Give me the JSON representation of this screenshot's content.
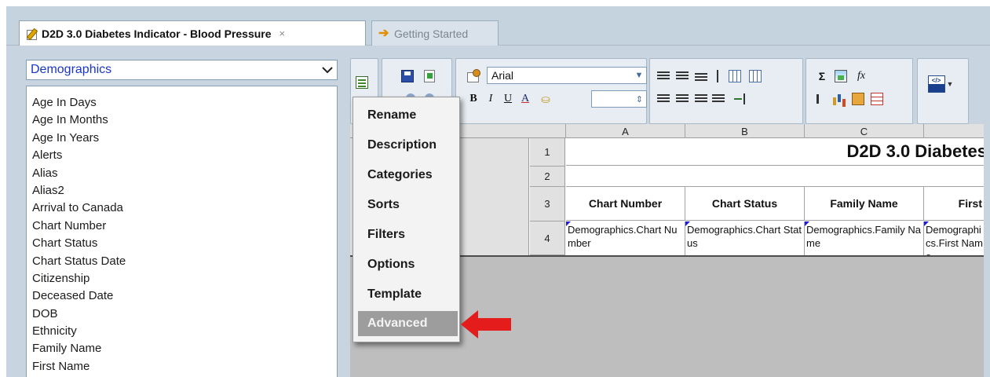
{
  "tabs": [
    {
      "label": "D2D 3.0 Diabetes Indicator - Blood Pressure",
      "close": "×",
      "active": true
    },
    {
      "label": "Getting Started",
      "active": false
    }
  ],
  "category_select": {
    "value": "Demographics"
  },
  "field_list": [
    "Age In Days",
    "Age In Months",
    "Age In Years",
    "Alerts",
    "Alias",
    "Alias2",
    "Arrival to Canada",
    "Chart Number",
    "Chart Status",
    "Chart Status Date",
    "Citizenship",
    "Deceased Date",
    "DOB",
    "Ethnicity",
    "Family Name",
    "First Name"
  ],
  "toolbar": {
    "font_family": "Arial",
    "bold": "B",
    "italic": "I",
    "underline": "U",
    "font_color": "A",
    "sum": "Σ",
    "function": "fx",
    "html": "</>"
  },
  "menu": [
    "Rename",
    "Description",
    "Categories",
    "Sorts",
    "Filters",
    "Options",
    "Template",
    "Advanced"
  ],
  "menu_selected": "Advanced",
  "sheet": {
    "column_letters": [
      "A",
      "B",
      "C"
    ],
    "row_numbers": [
      "1",
      "2",
      "3",
      "4"
    ],
    "title": "D2D 3.0 Diabetes",
    "headers": [
      "Chart Number",
      "Chart Status",
      "Family Name",
      "First"
    ],
    "data_row": [
      "Demographics.Chart Number",
      "Demographics.Chart Status",
      "Demographics.Family Name",
      "Demographics.First Name"
    ]
  },
  "colors": {
    "accent_red": "#e41c1c",
    "tab_bar": "#c5d3df",
    "link_blue": "#1a35c9"
  }
}
